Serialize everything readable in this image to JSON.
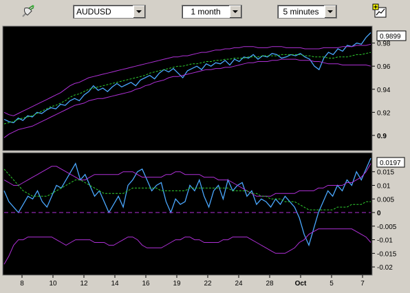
{
  "toolbar": {
    "symbol": "AUDUSD",
    "period": "1 month",
    "interval": "5 minutes",
    "icons": [
      "satellite-dish-icon",
      "add-chart-icon"
    ]
  },
  "top_panel": {
    "current_value": "0.9899",
    "y_ticks": [
      "0.98",
      "0.96",
      "0.94",
      "0.92",
      "0.9"
    ],
    "y_tick_values": [
      0.98,
      0.96,
      0.94,
      0.92,
      0.9
    ],
    "y_range": [
      0.888,
      0.9935
    ]
  },
  "bottom_panel": {
    "current_value": "0.0197",
    "y_ticks": [
      "0.015",
      "0.01",
      "0.005",
      "0",
      "-0.005",
      "-0.01",
      "-0.015",
      "-0.02"
    ],
    "y_tick_values": [
      0.015,
      0.01,
      0.005,
      0,
      -0.005,
      -0.01,
      -0.015,
      -0.02
    ],
    "y_range": [
      -0.0225,
      0.0215
    ]
  },
  "x_axis": {
    "labels": [
      "8",
      "10",
      "12",
      "14",
      "16",
      "19",
      "22",
      "24",
      "28",
      "Oct",
      "5",
      "7"
    ],
    "bold_labels": [
      "Oct"
    ]
  },
  "colors": {
    "background": "#000000",
    "price": "#4aa8ff",
    "envelope": "#b030d8",
    "moving_average": "#30d030",
    "zero_line": "#b030d8",
    "frame": "#d4d0c8"
  },
  "chart_data": [
    {
      "type": "line",
      "title": "",
      "series": [
        {
          "values": [
            0.914,
            0.912,
            0.911,
            0.915,
            0.913,
            0.917,
            0.916,
            0.92,
            0.919,
            0.922,
            0.924,
            0.923,
            0.927,
            0.926,
            0.93,
            0.932,
            0.93,
            0.935,
            0.938,
            0.943,
            0.939,
            0.941,
            0.938,
            0.942,
            0.945,
            0.942,
            0.944,
            0.946,
            0.943,
            0.948,
            0.95,
            0.952,
            0.949,
            0.954,
            0.957,
            0.955,
            0.958,
            0.954,
            0.95,
            0.956,
            0.958,
            0.96,
            0.957,
            0.962,
            0.96,
            0.963,
            0.962,
            0.965,
            0.961,
            0.966,
            0.964,
            0.968,
            0.967,
            0.97,
            0.966,
            0.969,
            0.968,
            0.971,
            0.97,
            0.967,
            0.968,
            0.97,
            0.969,
            0.971,
            0.968,
            0.966,
            0.96,
            0.957,
            0.967,
            0.972,
            0.97,
            0.975,
            0.973,
            0.978,
            0.977,
            0.98,
            0.979,
            0.985,
            0.989
          ]
        },
        {
          "values": [
            0.92,
            0.918,
            0.917,
            0.919,
            0.921,
            0.923,
            0.925,
            0.927,
            0.929,
            0.931,
            0.933,
            0.935,
            0.937,
            0.94,
            0.943,
            0.945,
            0.946,
            0.948,
            0.95,
            0.951,
            0.952,
            0.953,
            0.954,
            0.955,
            0.956,
            0.957,
            0.958,
            0.959,
            0.96,
            0.961,
            0.962,
            0.963,
            0.964,
            0.965,
            0.966,
            0.967,
            0.968,
            0.968,
            0.969,
            0.969,
            0.97,
            0.971,
            0.972,
            0.972,
            0.973,
            0.974,
            0.974,
            0.975,
            0.975,
            0.976,
            0.976,
            0.977,
            0.977,
            0.977,
            0.976,
            0.976,
            0.976,
            0.977,
            0.977,
            0.977,
            0.976,
            0.976,
            0.976,
            0.976,
            0.975,
            0.975,
            0.975,
            0.975,
            0.976,
            0.976,
            0.976,
            0.976,
            0.977,
            0.977,
            0.977,
            0.978,
            0.978,
            0.978,
            0.979
          ]
        },
        {
          "values": [
            0.898,
            0.901,
            0.903,
            0.905,
            0.906,
            0.907,
            0.908,
            0.91,
            0.912,
            0.914,
            0.916,
            0.918,
            0.92,
            0.922,
            0.924,
            0.926,
            0.927,
            0.928,
            0.93,
            0.931,
            0.932,
            0.932,
            0.933,
            0.934,
            0.935,
            0.936,
            0.937,
            0.938,
            0.94,
            0.941,
            0.943,
            0.944,
            0.946,
            0.947,
            0.948,
            0.95,
            0.951,
            0.951,
            0.952,
            0.953,
            0.954,
            0.955,
            0.956,
            0.957,
            0.957,
            0.958,
            0.958,
            0.959,
            0.959,
            0.96,
            0.961,
            0.962,
            0.963,
            0.963,
            0.964,
            0.964,
            0.964,
            0.965,
            0.965,
            0.966,
            0.966,
            0.966,
            0.966,
            0.965,
            0.965,
            0.965,
            0.964,
            0.964,
            0.963,
            0.962,
            0.962,
            0.962,
            0.961,
            0.961,
            0.961,
            0.961,
            0.961,
            0.961,
            0.96
          ]
        },
        {
          "values": [
            0.91,
            0.911,
            0.912,
            0.914,
            0.915,
            0.916,
            0.917,
            0.919,
            0.921,
            0.923,
            0.925,
            0.926,
            0.928,
            0.93,
            0.933,
            0.935,
            0.936,
            0.938,
            0.94,
            0.941,
            0.942,
            0.943,
            0.944,
            0.945,
            0.946,
            0.947,
            0.948,
            0.949,
            0.95,
            0.951,
            0.952,
            0.954,
            0.955,
            0.956,
            0.957,
            0.958,
            0.959,
            0.96,
            0.96,
            0.961,
            0.962,
            0.962,
            0.963,
            0.964,
            0.964,
            0.965,
            0.965,
            0.966,
            0.966,
            0.967,
            0.967,
            0.967,
            0.968,
            0.968,
            0.968,
            0.969,
            0.969,
            0.969,
            0.969,
            0.97,
            0.97,
            0.97,
            0.97,
            0.97,
            0.969,
            0.969,
            0.968,
            0.968,
            0.968,
            0.967,
            0.967,
            0.968,
            0.968,
            0.968,
            0.969,
            0.97,
            0.97,
            0.971,
            0.972
          ]
        }
      ],
      "ylim": [
        0.888,
        0.9935
      ]
    },
    {
      "type": "line",
      "title": "",
      "series": [
        {
          "values": [
            0.008,
            0.004,
            0.002,
            0.0,
            0.003,
            0.006,
            0.005,
            0.008,
            0.004,
            0.002,
            0.006,
            0.01,
            0.009,
            0.012,
            0.015,
            0.018,
            0.012,
            0.014,
            0.01,
            0.006,
            0.008,
            0.004,
            0.0,
            0.003,
            0.006,
            0.002,
            0.01,
            0.012,
            0.015,
            0.016,
            0.012,
            0.008,
            0.01,
            0.011,
            0.004,
            0.0,
            0.005,
            0.003,
            0.004,
            0.01,
            0.008,
            0.012,
            0.006,
            0.002,
            0.008,
            0.01,
            0.005,
            0.012,
            0.008,
            0.01,
            0.011,
            0.006,
            0.008,
            0.003,
            0.005,
            0.004,
            0.002,
            0.005,
            0.003,
            0.006,
            0.004,
            0.002,
            -0.002,
            -0.008,
            -0.012,
            -0.006,
            0.0,
            0.004,
            0.008,
            0.006,
            0.01,
            0.008,
            0.012,
            0.01,
            0.015,
            0.012,
            0.016,
            0.02
          ]
        },
        {
          "values": [
            0.012,
            0.011,
            0.01,
            0.01,
            0.011,
            0.012,
            0.013,
            0.014,
            0.015,
            0.016,
            0.017,
            0.017,
            0.016,
            0.015,
            0.014,
            0.013,
            0.012,
            0.012,
            0.013,
            0.014,
            0.014,
            0.014,
            0.014,
            0.014,
            0.014,
            0.015,
            0.015,
            0.015,
            0.014,
            0.013,
            0.013,
            0.013,
            0.013,
            0.013,
            0.014,
            0.014,
            0.015,
            0.015,
            0.014,
            0.014,
            0.014,
            0.014,
            0.013,
            0.013,
            0.013,
            0.012,
            0.012,
            0.012,
            0.011,
            0.01,
            0.009,
            0.008,
            0.007,
            0.006,
            0.006,
            0.006,
            0.006,
            0.007,
            0.007,
            0.007,
            0.007,
            0.007,
            0.008,
            0.008,
            0.008,
            0.008,
            0.009,
            0.009,
            0.01,
            0.01,
            0.01,
            0.01,
            0.011,
            0.011,
            0.012,
            0.013,
            0.015,
            0.018
          ]
        },
        {
          "values": [
            -0.019,
            -0.016,
            -0.012,
            -0.01,
            -0.01,
            -0.009,
            -0.009,
            -0.009,
            -0.009,
            -0.009,
            -0.009,
            -0.01,
            -0.011,
            -0.012,
            -0.011,
            -0.01,
            -0.01,
            -0.01,
            -0.01,
            -0.011,
            -0.011,
            -0.011,
            -0.012,
            -0.012,
            -0.011,
            -0.01,
            -0.009,
            -0.009,
            -0.01,
            -0.012,
            -0.013,
            -0.013,
            -0.013,
            -0.013,
            -0.012,
            -0.011,
            -0.01,
            -0.01,
            -0.009,
            -0.009,
            -0.01,
            -0.01,
            -0.011,
            -0.011,
            -0.011,
            -0.011,
            -0.01,
            -0.01,
            -0.009,
            -0.009,
            -0.009,
            -0.009,
            -0.01,
            -0.011,
            -0.012,
            -0.013,
            -0.014,
            -0.015,
            -0.015,
            -0.015,
            -0.014,
            -0.013,
            -0.011,
            -0.01,
            -0.008,
            -0.007,
            -0.006,
            -0.006,
            -0.006,
            -0.006,
            -0.006,
            -0.006,
            -0.006,
            -0.006,
            -0.007,
            -0.008,
            -0.009,
            -0.011
          ]
        },
        {
          "values": [
            0.016,
            0.014,
            0.012,
            0.01,
            0.008,
            0.007,
            0.006,
            0.006,
            0.006,
            0.006,
            0.007,
            0.008,
            0.009,
            0.01,
            0.011,
            0.012,
            0.012,
            0.011,
            0.01,
            0.009,
            0.008,
            0.007,
            0.007,
            0.007,
            0.007,
            0.007,
            0.008,
            0.009,
            0.009,
            0.009,
            0.009,
            0.009,
            0.009,
            0.008,
            0.008,
            0.008,
            0.008,
            0.008,
            0.008,
            0.009,
            0.009,
            0.009,
            0.009,
            0.009,
            0.009,
            0.009,
            0.009,
            0.009,
            0.008,
            0.008,
            0.008,
            0.008,
            0.007,
            0.007,
            0.006,
            0.006,
            0.005,
            0.005,
            0.005,
            0.004,
            0.004,
            0.004,
            0.003,
            0.002,
            0.001,
            0.001,
            0.001,
            0.001,
            0.001,
            0.001,
            0.002,
            0.002,
            0.002,
            0.003,
            0.003,
            0.003,
            0.004,
            0.004
          ]
        }
      ],
      "ylim": [
        -0.0225,
        0.0215
      ]
    }
  ]
}
